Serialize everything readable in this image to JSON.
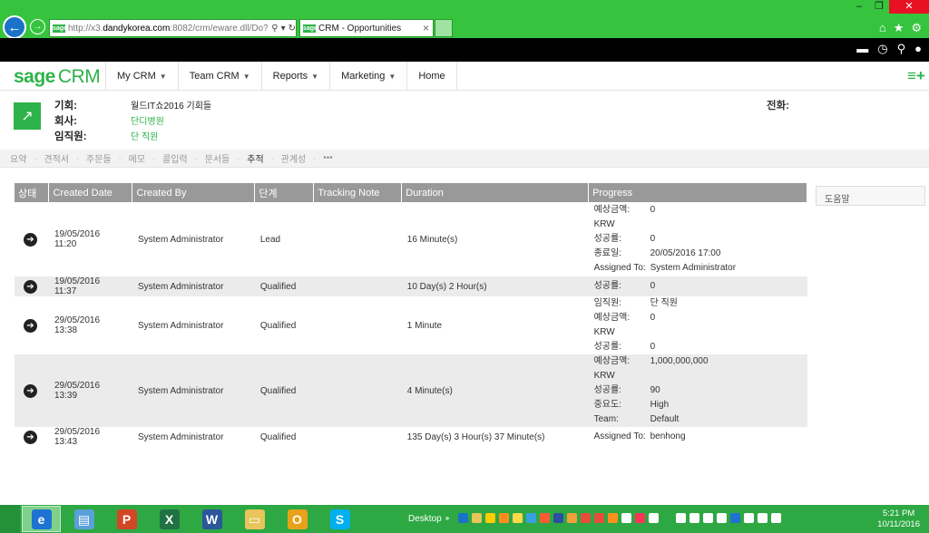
{
  "browser": {
    "url_prefix": "http://x3.",
    "url_domain": "dandykorea.com",
    "url_suffix": ":8082/crm/eware.dll/Do?SID",
    "search_glyph": "⚲",
    "refresh_glyph": "↻",
    "tab_title": "CRM - Opportunities",
    "favicon_text": "sage"
  },
  "menu": {
    "logo_sage": "sage",
    "logo_crm": "CRM",
    "items": [
      {
        "label": "My CRM"
      },
      {
        "label": "Team CRM"
      },
      {
        "label": "Reports"
      },
      {
        "label": "Marketing"
      },
      {
        "label": "Home"
      }
    ]
  },
  "entity": {
    "opportunity_label": "기회:",
    "opportunity_value": "월드IT쇼2016 기회들",
    "company_label": "회사:",
    "company_value": "단디병원",
    "person_label": "임직원:",
    "person_value": "단 직원",
    "phone_label": "전화:"
  },
  "tabs": [
    {
      "label": "요약",
      "active": false
    },
    {
      "label": "견적서",
      "active": false
    },
    {
      "label": "주문들",
      "active": false
    },
    {
      "label": "메모",
      "active": false
    },
    {
      "label": "콜입력",
      "active": false
    },
    {
      "label": "문서들",
      "active": false
    },
    {
      "label": "추적",
      "active": true
    },
    {
      "label": "관계성",
      "active": false
    },
    {
      "label": "•••",
      "active": false
    }
  ],
  "table": {
    "headers": [
      "상태",
      "Created Date",
      "Created By",
      "단계",
      "Tracking Note",
      "Duration",
      "Progress"
    ],
    "rows": [
      {
        "date": "19/05/2016",
        "time": "11:20",
        "by": "System Administrator",
        "stage": "Lead",
        "note": "",
        "duration": "16 Minute(s)",
        "progress": [
          {
            "k": "예상금액: KRW",
            "v": "0"
          },
          {
            "k": "성공률:",
            "v": "0"
          },
          {
            "k": "종료일:",
            "v": "20/05/2016 17:00"
          },
          {
            "k": "Assigned To:",
            "v": "System Administrator"
          }
        ]
      },
      {
        "date": "19/05/2016",
        "time": "11:37",
        "by": "System Administrator",
        "stage": "Qualified",
        "note": "",
        "duration": "10 Day(s) 2 Hour(s)",
        "progress": [
          {
            "k": "성공률:",
            "v": "0"
          }
        ]
      },
      {
        "date": "29/05/2016",
        "time": "13:38",
        "by": "System Administrator",
        "stage": "Qualified",
        "note": "",
        "duration": "1 Minute",
        "progress": [
          {
            "k": "임직원:",
            "v": "단 직원"
          },
          {
            "k": "예상금액: KRW",
            "v": "0"
          },
          {
            "k": "성공률:",
            "v": "0"
          }
        ]
      },
      {
        "date": "29/05/2016",
        "time": "13:39",
        "by": "System Administrator",
        "stage": "Qualified",
        "note": "",
        "duration": "4 Minute(s)",
        "progress": [
          {
            "k": "예상금액: KRW",
            "v": "1,000,000,000"
          },
          {
            "k": "성공률:",
            "v": "90"
          },
          {
            "k": "중요도:",
            "v": "High"
          },
          {
            "k": "Team:",
            "v": "Default"
          }
        ]
      },
      {
        "date": "29/05/2016",
        "time": "13:43",
        "by": "System Administrator",
        "stage": "Qualified",
        "note": "",
        "duration": "135 Day(s) 3 Hour(s) 37 Minute(s)",
        "progress": [
          {
            "k": "Assigned To:",
            "v": "benhong"
          }
        ]
      }
    ]
  },
  "help_label": "도움말",
  "taskbar": {
    "desktop_label": "Desktop",
    "time": "5:21 PM",
    "date": "10/11/2016",
    "pins": [
      {
        "name": "ie",
        "glyph": "e",
        "color": "#1e73d2",
        "active": true
      },
      {
        "name": "files",
        "glyph": "▤",
        "color": "#5aa0d8",
        "active": false
      },
      {
        "name": "powerpoint",
        "glyph": "P",
        "color": "#d24726",
        "active": false
      },
      {
        "name": "excel",
        "glyph": "X",
        "color": "#207245",
        "active": false
      },
      {
        "name": "word",
        "glyph": "W",
        "color": "#2b579a",
        "active": false
      },
      {
        "name": "explorer",
        "glyph": "▭",
        "color": "#e8c45a",
        "active": false
      },
      {
        "name": "outlook",
        "glyph": "O",
        "color": "#e8a21a",
        "active": false
      },
      {
        "name": "skype",
        "glyph": "S",
        "color": "#00aff0",
        "active": false
      }
    ],
    "tray_colors": [
      "#1a73c8",
      "#e8c45a",
      "#ffcc00",
      "#ff8c1a",
      "#ffd84d",
      "#3aa0e0",
      "#ff5a36",
      "#2b4fa0",
      "#f2a03a",
      "#e84c3a",
      "#e84c3a",
      "#ff9020",
      "#ffffff",
      "#ff3355",
      "#ffffff",
      "#2ea843",
      "#ffffff",
      "#ffffff",
      "#ffffff",
      "#ffffff",
      "#1e73d2",
      "#ffffff",
      "#ffffff",
      "#ffffff"
    ]
  }
}
